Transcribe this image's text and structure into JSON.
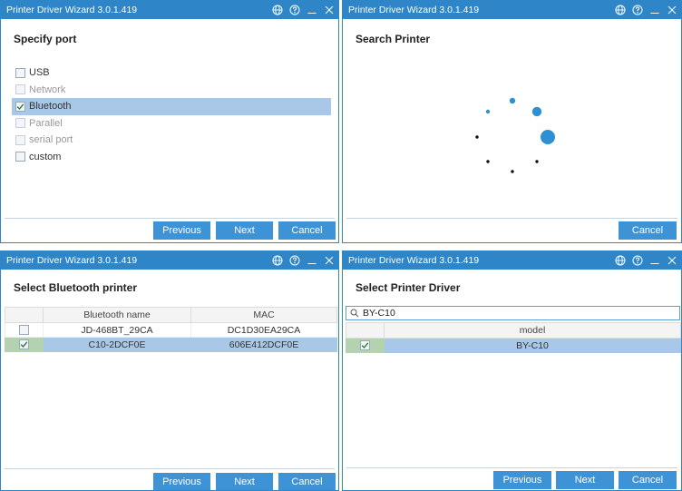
{
  "window_title": "Printer Driver Wizard  3.0.1.419",
  "title_icons": [
    "globe-icon",
    "help-icon",
    "minimize-icon",
    "close-icon"
  ],
  "colors": {
    "accent": "#2e86c8",
    "button": "#3e92d6",
    "selection": "#a9c8e8",
    "check_cell": "#b2d2b0"
  },
  "specify_port": {
    "heading": "Specify port",
    "options": [
      {
        "label": "USB",
        "checked": false,
        "disabled": false,
        "selected": false
      },
      {
        "label": "Network",
        "checked": false,
        "disabled": true,
        "selected": false
      },
      {
        "label": "Bluetooth",
        "checked": true,
        "disabled": false,
        "selected": true
      },
      {
        "label": "Parallel",
        "checked": false,
        "disabled": true,
        "selected": false
      },
      {
        "label": "serial port",
        "checked": false,
        "disabled": true,
        "selected": false
      },
      {
        "label": "custom",
        "checked": false,
        "disabled": false,
        "selected": false
      }
    ],
    "buttons": {
      "previous": "Previous",
      "next": "Next",
      "cancel": "Cancel"
    }
  },
  "search_printer": {
    "heading": "Search Printer",
    "buttons": {
      "cancel": "Cancel"
    }
  },
  "select_bluetooth": {
    "heading": "Select Bluetooth printer",
    "columns": [
      "Bluetooth name",
      "MAC"
    ],
    "rows": [
      {
        "name": "JD-468BT_29CA",
        "mac": "DC1D30EA29CA",
        "checked": false,
        "selected": false
      },
      {
        "name": "C10-2DCF0E",
        "mac": "606E412DCF0E",
        "checked": true,
        "selected": true
      }
    ],
    "buttons": {
      "previous": "Previous",
      "next": "Next",
      "cancel": "Cancel"
    }
  },
  "select_driver": {
    "heading": "Select Printer Driver",
    "search_value": "BY-C10",
    "columns": [
      "model"
    ],
    "rows": [
      {
        "model": "BY-C10",
        "checked": true,
        "selected": true
      }
    ],
    "buttons": {
      "previous": "Previous",
      "next": "Next",
      "cancel": "Cancel"
    }
  }
}
